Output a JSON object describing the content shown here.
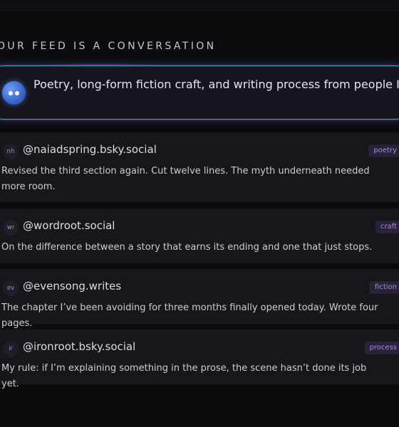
{
  "feed": {
    "heading": "OUR FEED IS A CONVERSATION",
    "prompt": "Poetry, long-form fiction craft, and writing process from people I follow"
  },
  "posts": [
    {
      "initials": "nh",
      "handle": "@naiadspring.bsky.social",
      "tag": "poetry",
      "text": "Revised the third section again. Cut twelve lines. The myth underneath needed more room."
    },
    {
      "initials": "wr",
      "handle": "@wordroot.social",
      "tag": "craft",
      "text": "On the difference between a story that earns its ending and one that just stops."
    },
    {
      "initials": "ev",
      "handle": "@evensong.writes",
      "tag": "fiction",
      "text": "The chapter I’ve been avoiding for three months finally opened today. Wrote four pages."
    },
    {
      "initials": "ir",
      "handle": "@ironroot.bsky.social",
      "tag": "process",
      "text": "My rule: if I’m explaining something in the prose, the scene hasn’t done its job yet."
    }
  ],
  "colors": {
    "background": "#0b0b0e",
    "card": "#17171b",
    "accent_tag_bg": "#2a2238",
    "accent_tag_text": "#a58ddb",
    "prompt_border": "#4aa3c9",
    "avatar": "#3a64c9"
  }
}
